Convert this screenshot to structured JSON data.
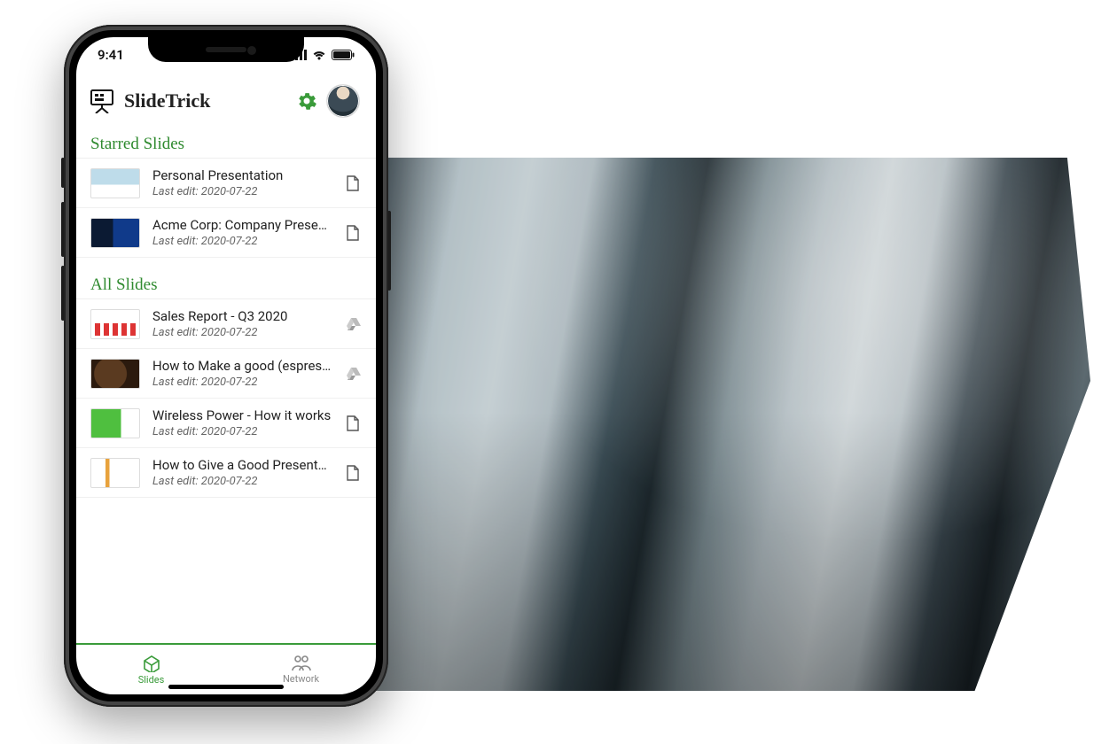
{
  "status": {
    "time": "9:41"
  },
  "brand": {
    "name": "SlideTrick"
  },
  "sections": {
    "starred": {
      "heading": "Starred Slides"
    },
    "all": {
      "heading": "All Slides"
    }
  },
  "slides": {
    "starred": [
      {
        "title": "Personal Presentation",
        "subtitle": "Last edit: 2020-07-22",
        "filetype": "pdf"
      },
      {
        "title": "Acme Corp: Company Presentation",
        "subtitle": "Last edit: 2020-07-22",
        "filetype": "pdf"
      }
    ],
    "all": [
      {
        "title": "Sales Report - Q3 2020",
        "subtitle": "Last edit: 2020-07-22",
        "filetype": "drive"
      },
      {
        "title": "How to Make a good (espresso) c…",
        "subtitle": "Last edit: 2020-07-22",
        "filetype": "drive"
      },
      {
        "title": "Wireless Power - How it works",
        "subtitle": "Last edit: 2020-07-22",
        "filetype": "pdf"
      },
      {
        "title": "How to Give a Good Presentation",
        "subtitle": "Last edit: 2020-07-22",
        "filetype": "pdf"
      }
    ]
  },
  "tabs": {
    "slides": "Slides",
    "network": "Network"
  },
  "colors": {
    "accent": "#3a9b3a"
  }
}
